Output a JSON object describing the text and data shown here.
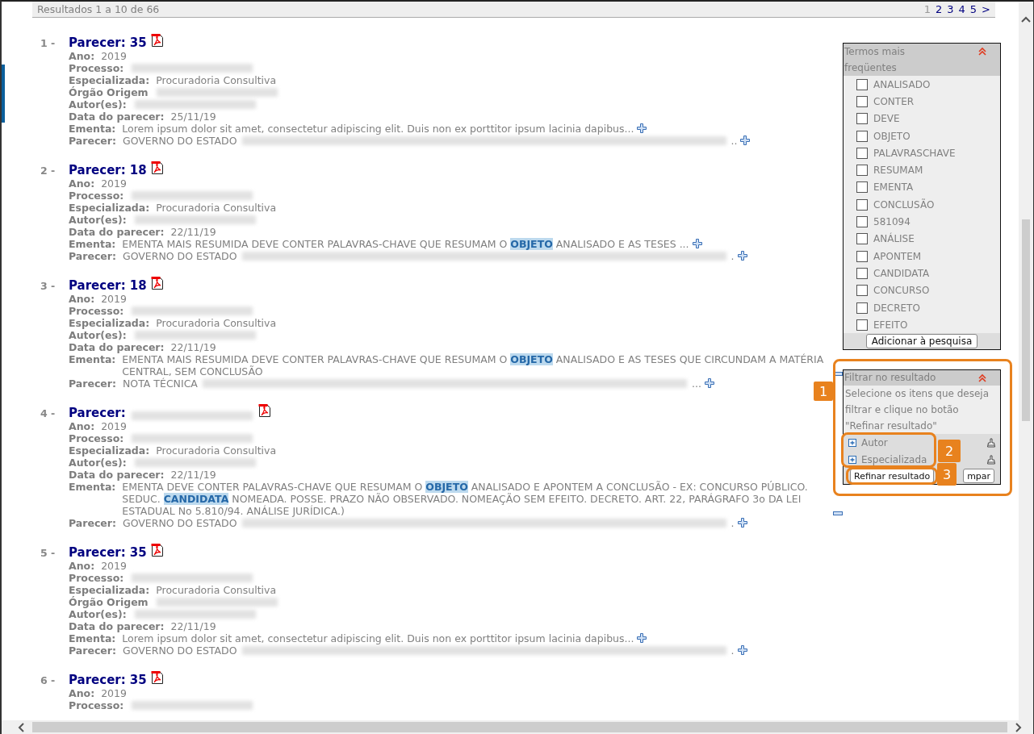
{
  "header": {
    "summary": "Resultados 1 a 10 de 66",
    "pages": [
      {
        "label": "1",
        "selected": true
      },
      {
        "label": "2",
        "selected": false
      },
      {
        "label": "3",
        "selected": false
      },
      {
        "label": "4",
        "selected": false
      },
      {
        "label": "5",
        "selected": false
      }
    ],
    "next": ">"
  },
  "results": [
    {
      "number": "1 -",
      "title": "Parecer:",
      "title_value": {
        "kind": "text",
        "text": "35"
      },
      "fields": [
        {
          "label": "Ano:",
          "parts": [
            {
              "kind": "text",
              "text": "2019"
            }
          ]
        },
        {
          "label": "Processo:",
          "parts": [
            {
              "kind": "redacted"
            }
          ]
        },
        {
          "label": "Especializada:",
          "parts": [
            {
              "kind": "text",
              "text": "Procuradoria Consultiva"
            }
          ]
        },
        {
          "label": "Órgão Origem",
          "parts": [
            {
              "kind": "redacted"
            }
          ]
        },
        {
          "label": "Autor(es):",
          "parts": [
            {
              "kind": "redacted"
            }
          ]
        },
        {
          "label": "Data do parecer:",
          "parts": [
            {
              "kind": "text",
              "text": "25/11/19"
            }
          ]
        },
        {
          "label": "Ementa:",
          "parts": [
            {
              "kind": "text",
              "text": "Lorem ipsum dolor sit amet, consectetur adipiscing elit. Duis non ex porttitor ipsum lacinia dapibus..."
            }
          ],
          "expanded": false
        },
        {
          "label": "Parecer:",
          "parts": [
            {
              "kind": "text",
              "text": "GOVERNO DO ESTADO"
            },
            {
              "kind": "redacted"
            },
            {
              "kind": "text",
              "text": ".."
            }
          ],
          "expanded": false
        }
      ]
    },
    {
      "number": "2 -",
      "title": "Parecer:",
      "title_value": {
        "kind": "text",
        "text": "18"
      },
      "fields": [
        {
          "label": "Ano:",
          "parts": [
            {
              "kind": "text",
              "text": "2019"
            }
          ]
        },
        {
          "label": "Processo:",
          "parts": [
            {
              "kind": "redacted"
            }
          ]
        },
        {
          "label": "Especializada:",
          "parts": [
            {
              "kind": "text",
              "text": "Procuradoria Consultiva"
            }
          ]
        },
        {
          "label": "Autor(es):",
          "parts": [
            {
              "kind": "redacted"
            }
          ]
        },
        {
          "label": "Data do parecer:",
          "parts": [
            {
              "kind": "text",
              "text": "22/11/19"
            }
          ]
        },
        {
          "label": "Ementa:",
          "parts": [
            {
              "kind": "text",
              "text": "EMENTA MAIS RESUMIDA DEVE CONTER PALAVRAS-CHAVE QUE RESUMAM O"
            },
            {
              "kind": "highlight",
              "text": "OBJETO"
            },
            {
              "kind": "text",
              "text": "ANALISADO E AS TESES ..."
            }
          ],
          "expanded": false
        },
        {
          "label": "Parecer:",
          "parts": [
            {
              "kind": "text",
              "text": "GOVERNO DO ESTADO"
            },
            {
              "kind": "redacted"
            },
            {
              "kind": "text",
              "text": "."
            }
          ],
          "expanded": false
        }
      ]
    },
    {
      "number": "3 -",
      "title": "Parecer:",
      "title_value": {
        "kind": "text",
        "text": "18"
      },
      "fields": [
        {
          "label": "Ano:",
          "parts": [
            {
              "kind": "text",
              "text": "2019"
            }
          ]
        },
        {
          "label": "Processo:",
          "parts": [
            {
              "kind": "redacted"
            }
          ]
        },
        {
          "label": "Especializada:",
          "parts": [
            {
              "kind": "text",
              "text": "Procuradoria Consultiva"
            }
          ]
        },
        {
          "label": "Autor(es):",
          "parts": [
            {
              "kind": "redacted"
            }
          ]
        },
        {
          "label": "Data do parecer:",
          "parts": [
            {
              "kind": "text",
              "text": "22/11/19"
            }
          ]
        },
        {
          "label": "Ementa:",
          "parts": [
            {
              "kind": "text",
              "text": "EMENTA MAIS RESUMIDA DEVE CONTER PALAVRAS-CHAVE QUE RESUMAM O"
            },
            {
              "kind": "highlight",
              "text": "OBJETO"
            },
            {
              "kind": "text",
              "text": "ANALISADO E AS TESES QUE CIRCUNDAM A MATÉRIA CENTRAL, SEM CONCLUSÃO"
            }
          ],
          "expanded": true
        },
        {
          "label": "Parecer:",
          "parts": [
            {
              "kind": "text",
              "text": "NOTA TÉCNICA"
            },
            {
              "kind": "redacted"
            },
            {
              "kind": "text",
              "text": "..."
            }
          ],
          "expanded": false
        }
      ]
    },
    {
      "number": "4 -",
      "title": "Parecer:",
      "title_value": {
        "kind": "redacted"
      },
      "fields": [
        {
          "label": "Ano:",
          "parts": [
            {
              "kind": "text",
              "text": "2019"
            }
          ]
        },
        {
          "label": "Processo:",
          "parts": [
            {
              "kind": "redacted"
            }
          ]
        },
        {
          "label": "Especializada:",
          "parts": [
            {
              "kind": "text",
              "text": "Procuradoria Consultiva"
            }
          ]
        },
        {
          "label": "Autor(es):",
          "parts": [
            {
              "kind": "redacted"
            }
          ]
        },
        {
          "label": "Data do parecer:",
          "parts": [
            {
              "kind": "text",
              "text": "22/11/19"
            }
          ]
        },
        {
          "label": "Ementa:",
          "parts": [
            {
              "kind": "text",
              "text": "EMENTA DEVE CONTER PALAVRAS-CHAVE QUE RESUMAM O"
            },
            {
              "kind": "highlight",
              "text": "OBJETO"
            },
            {
              "kind": "text",
              "text": "ANALISADO E APONTEM A CONCLUSÃO - EX: CONCURSO PÚBLICO. SEDUC."
            },
            {
              "kind": "highlight",
              "text": "CANDIDATA"
            },
            {
              "kind": "text",
              "text": "NOMEADA. POSSE. PRAZO NÃO OBSERVADO. NOMEAÇÃO SEM EFEITO. DECRETO. ART. 22, PARÁGRAFO 3o DA LEI ESTADUAL No 5.810/94. ANÁLISE JURÍDICA.)"
            }
          ],
          "expanded": true
        },
        {
          "label": "Parecer:",
          "parts": [
            {
              "kind": "text",
              "text": "GOVERNO DO ESTADO"
            },
            {
              "kind": "redacted"
            },
            {
              "kind": "text",
              "text": "."
            }
          ],
          "expanded": false
        }
      ]
    },
    {
      "number": "5 -",
      "title": "Parecer:",
      "title_value": {
        "kind": "text",
        "text": "35"
      },
      "fields": [
        {
          "label": "Ano:",
          "parts": [
            {
              "kind": "text",
              "text": "2019"
            }
          ]
        },
        {
          "label": "Processo:",
          "parts": [
            {
              "kind": "redacted"
            }
          ]
        },
        {
          "label": "Especializada:",
          "parts": [
            {
              "kind": "text",
              "text": "Procuradoria Consultiva"
            }
          ]
        },
        {
          "label": "Órgão Origem",
          "parts": [
            {
              "kind": "redacted"
            }
          ]
        },
        {
          "label": "Autor(es):",
          "parts": [
            {
              "kind": "redacted"
            }
          ]
        },
        {
          "label": "Data do parecer:",
          "parts": [
            {
              "kind": "text",
              "text": "22/11/19"
            }
          ]
        },
        {
          "label": "Ementa:",
          "parts": [
            {
              "kind": "text",
              "text": "Lorem ipsum dolor sit amet, consectetur adipiscing elit. Duis non ex porttitor ipsum lacinia dapibus..."
            }
          ],
          "expanded": false
        },
        {
          "label": "Parecer:",
          "parts": [
            {
              "kind": "text",
              "text": "GOVERNO DO ESTADO"
            },
            {
              "kind": "redacted"
            },
            {
              "kind": "text",
              "text": "."
            }
          ],
          "expanded": false
        }
      ]
    },
    {
      "number": "6 -",
      "title": "Parecer:",
      "title_value": {
        "kind": "text",
        "text": "35"
      },
      "fields": [
        {
          "label": "Ano:",
          "parts": [
            {
              "kind": "text",
              "text": "2019"
            }
          ]
        },
        {
          "label": "Processo:",
          "parts": [
            {
              "kind": "redacted"
            }
          ]
        }
      ]
    }
  ],
  "terms_panel": {
    "title": "Termos mais freqüentes",
    "terms": [
      {
        "label": "ANALISADO",
        "checked": false
      },
      {
        "label": "CONTER",
        "checked": false
      },
      {
        "label": "DEVE",
        "checked": false
      },
      {
        "label": "OBJETO",
        "checked": false
      },
      {
        "label": "PALAVRASCHAVE",
        "checked": false
      },
      {
        "label": "RESUMAM",
        "checked": false
      },
      {
        "label": "EMENTA",
        "checked": false
      },
      {
        "label": "CONCLUSÃO",
        "checked": false
      },
      {
        "label": "581094",
        "checked": false
      },
      {
        "label": "ANÁLISE",
        "checked": false
      },
      {
        "label": "APONTEM",
        "checked": false
      },
      {
        "label": "CANDIDATA",
        "checked": false
      },
      {
        "label": "CONCURSO",
        "checked": false
      },
      {
        "label": "DECRETO",
        "checked": false
      },
      {
        "label": "EFEITO",
        "checked": false
      }
    ],
    "button": "Adicionar à pesquisa"
  },
  "filter_panel": {
    "title": "Filtrar no resultado",
    "description": "Selecione os itens que deseja filtrar e clique no botão \"Refinar resultado\"",
    "groups": [
      {
        "label": "Autor",
        "expanded": false
      },
      {
        "label": "Especializada",
        "expanded": false
      }
    ],
    "buttons": [
      "Refinar resultado",
      "mpar"
    ]
  },
  "callouts": [
    "1",
    "2",
    "3"
  ]
}
